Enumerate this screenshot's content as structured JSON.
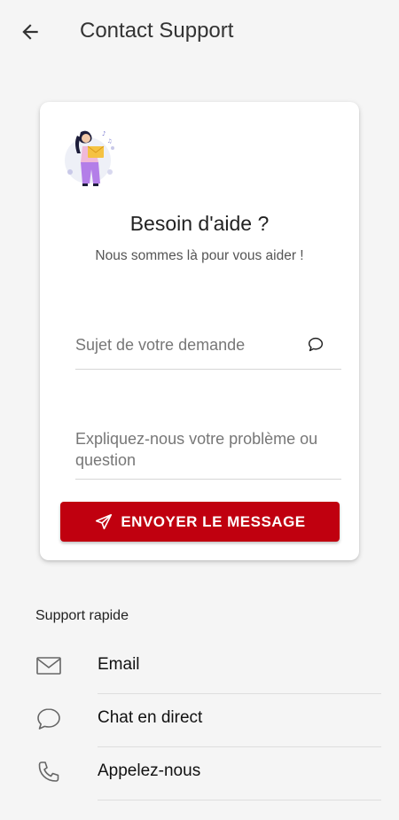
{
  "header": {
    "title": "Contact Support",
    "back_icon": "arrow-left-icon"
  },
  "card": {
    "title": "Besoin d'aide ?",
    "subtitle": "Nous sommes là pour vous aider !",
    "illustration": "support-woman-illustration",
    "subject_field": {
      "value": "",
      "placeholder": "Sujet de votre demande",
      "icon": "chat-bubble-icon"
    },
    "message_field": {
      "value": "",
      "placeholder": "Expliquez-nous votre problème ou question"
    },
    "send_button": {
      "label": "ENVOYER LE MESSAGE",
      "icon": "send-icon"
    }
  },
  "quick_support": {
    "title": "Support rapide",
    "items": [
      {
        "label": "Email",
        "icon": "mail-icon"
      },
      {
        "label": "Chat en direct",
        "icon": "chat-icon"
      },
      {
        "label": "Appelez-nous",
        "icon": "phone-icon"
      }
    ]
  },
  "colors": {
    "accent": "#c0000f",
    "background": "#f5f5f5",
    "card": "#ffffff"
  }
}
